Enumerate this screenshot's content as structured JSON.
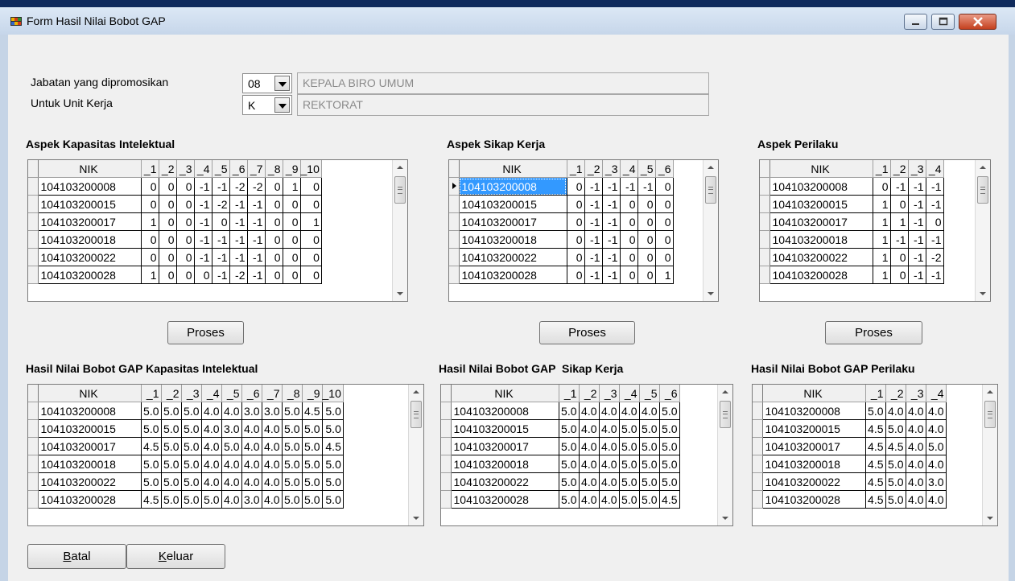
{
  "window": {
    "title": "Form Hasil Nilai Bobot GAP"
  },
  "form": {
    "jabatan_label": "Jabatan yang dipromosikan",
    "jabatan_code": "08",
    "jabatan_name": "KEPALA BIRO UMUM",
    "unit_label": "Untuk Unit Kerja",
    "unit_code": "K",
    "unit_name": "REKTORAT"
  },
  "aspects": {
    "intelektual": {
      "title": "Aspek Kapasitas Intelektual",
      "columns": [
        "NIK",
        "_1",
        "_2",
        "_3",
        "_4",
        "_5",
        "_6",
        "_7",
        "_8",
        "_9",
        "_10"
      ],
      "rows": [
        [
          "104103200008",
          "0",
          "0",
          "0",
          "-1",
          "-1",
          "-2",
          "-2",
          "0",
          "1",
          "0"
        ],
        [
          "104103200015",
          "0",
          "0",
          "0",
          "-1",
          "-2",
          "-1",
          "-1",
          "0",
          "0",
          "0"
        ],
        [
          "104103200017",
          "1",
          "0",
          "0",
          "-1",
          "0",
          "-1",
          "-1",
          "0",
          "0",
          "1"
        ],
        [
          "104103200018",
          "0",
          "0",
          "0",
          "-1",
          "-1",
          "-1",
          "-1",
          "0",
          "0",
          "0"
        ],
        [
          "104103200022",
          "0",
          "0",
          "0",
          "-1",
          "-1",
          "-1",
          "-1",
          "0",
          "0",
          "0"
        ],
        [
          "104103200028",
          "1",
          "0",
          "0",
          "0",
          "-1",
          "-2",
          "-1",
          "0",
          "0",
          "0"
        ]
      ]
    },
    "sikap": {
      "title": "Aspek Sikap Kerja",
      "columns": [
        "NIK",
        "_1",
        "_2",
        "_3",
        "_4",
        "_5",
        "_6"
      ],
      "rows": [
        [
          "104103200008",
          "0",
          "-1",
          "-1",
          "-1",
          "-1",
          "0"
        ],
        [
          "104103200015",
          "0",
          "-1",
          "-1",
          "0",
          "0",
          "0"
        ],
        [
          "104103200017",
          "0",
          "-1",
          "-1",
          "0",
          "0",
          "0"
        ],
        [
          "104103200018",
          "0",
          "-1",
          "-1",
          "0",
          "0",
          "0"
        ],
        [
          "104103200022",
          "0",
          "-1",
          "-1",
          "0",
          "0",
          "0"
        ],
        [
          "104103200028",
          "0",
          "-1",
          "-1",
          "0",
          "0",
          "1"
        ]
      ]
    },
    "perilaku": {
      "title": "Aspek Perilaku",
      "columns": [
        "NIK",
        "_1",
        "_2",
        "_3",
        "_4"
      ],
      "rows": [
        [
          "104103200008",
          "0",
          "-1",
          "-1",
          "-1"
        ],
        [
          "104103200015",
          "1",
          "0",
          "-1",
          "-1"
        ],
        [
          "104103200017",
          "1",
          "1",
          "-1",
          "0"
        ],
        [
          "104103200018",
          "1",
          "-1",
          "-1",
          "-1"
        ],
        [
          "104103200022",
          "1",
          "0",
          "-1",
          "-2"
        ],
        [
          "104103200028",
          "1",
          "0",
          "-1",
          "-1"
        ]
      ]
    }
  },
  "results": {
    "intelektual": {
      "title": "Hasil Nilai Bobot GAP Kapasitas Intelektual",
      "columns": [
        "NIK",
        "_1",
        "_2",
        "_3",
        "_4",
        "_5",
        "_6",
        "_7",
        "_8",
        "_9",
        "_10"
      ],
      "rows": [
        [
          "104103200008",
          "5.0",
          "5.0",
          "5.0",
          "4.0",
          "4.0",
          "3.0",
          "3.0",
          "5.0",
          "4.5",
          "5.0"
        ],
        [
          "104103200015",
          "5.0",
          "5.0",
          "5.0",
          "4.0",
          "3.0",
          "4.0",
          "4.0",
          "5.0",
          "5.0",
          "5.0"
        ],
        [
          "104103200017",
          "4.5",
          "5.0",
          "5.0",
          "4.0",
          "5.0",
          "4.0",
          "4.0",
          "5.0",
          "5.0",
          "4.5"
        ],
        [
          "104103200018",
          "5.0",
          "5.0",
          "5.0",
          "4.0",
          "4.0",
          "4.0",
          "4.0",
          "5.0",
          "5.0",
          "5.0"
        ],
        [
          "104103200022",
          "5.0",
          "5.0",
          "5.0",
          "4.0",
          "4.0",
          "4.0",
          "4.0",
          "5.0",
          "5.0",
          "5.0"
        ],
        [
          "104103200028",
          "4.5",
          "5.0",
          "5.0",
          "5.0",
          "4.0",
          "3.0",
          "4.0",
          "5.0",
          "5.0",
          "5.0"
        ]
      ]
    },
    "sikap": {
      "title": "Hasil Nilai Bobot GAP  Sikap Kerja",
      "columns": [
        "NIK",
        "_1",
        "_2",
        "_3",
        "_4",
        "_5",
        "_6"
      ],
      "rows": [
        [
          "104103200008",
          "5.0",
          "4.0",
          "4.0",
          "4.0",
          "4.0",
          "5.0"
        ],
        [
          "104103200015",
          "5.0",
          "4.0",
          "4.0",
          "5.0",
          "5.0",
          "5.0"
        ],
        [
          "104103200017",
          "5.0",
          "4.0",
          "4.0",
          "5.0",
          "5.0",
          "5.0"
        ],
        [
          "104103200018",
          "5.0",
          "4.0",
          "4.0",
          "5.0",
          "5.0",
          "5.0"
        ],
        [
          "104103200022",
          "5.0",
          "4.0",
          "4.0",
          "5.0",
          "5.0",
          "5.0"
        ],
        [
          "104103200028",
          "5.0",
          "4.0",
          "4.0",
          "5.0",
          "5.0",
          "4.5"
        ]
      ]
    },
    "perilaku": {
      "title": "Hasil Nilai Bobot GAP Perilaku",
      "columns": [
        "NIK",
        "_1",
        "_2",
        "_3",
        "_4"
      ],
      "rows": [
        [
          "104103200008",
          "5.0",
          "4.0",
          "4.0",
          "4.0"
        ],
        [
          "104103200015",
          "4.5",
          "5.0",
          "4.0",
          "4.0"
        ],
        [
          "104103200017",
          "4.5",
          "4.5",
          "4.0",
          "5.0"
        ],
        [
          "104103200018",
          "4.5",
          "5.0",
          "4.0",
          "4.0"
        ],
        [
          "104103200022",
          "4.5",
          "5.0",
          "4.0",
          "3.0"
        ],
        [
          "104103200028",
          "4.5",
          "5.0",
          "4.0",
          "4.0"
        ]
      ]
    }
  },
  "buttons": {
    "proses": "Proses",
    "batal_accel": "B",
    "batal_rest": "atal",
    "keluar_accel": "K",
    "keluar_rest": "eluar"
  }
}
